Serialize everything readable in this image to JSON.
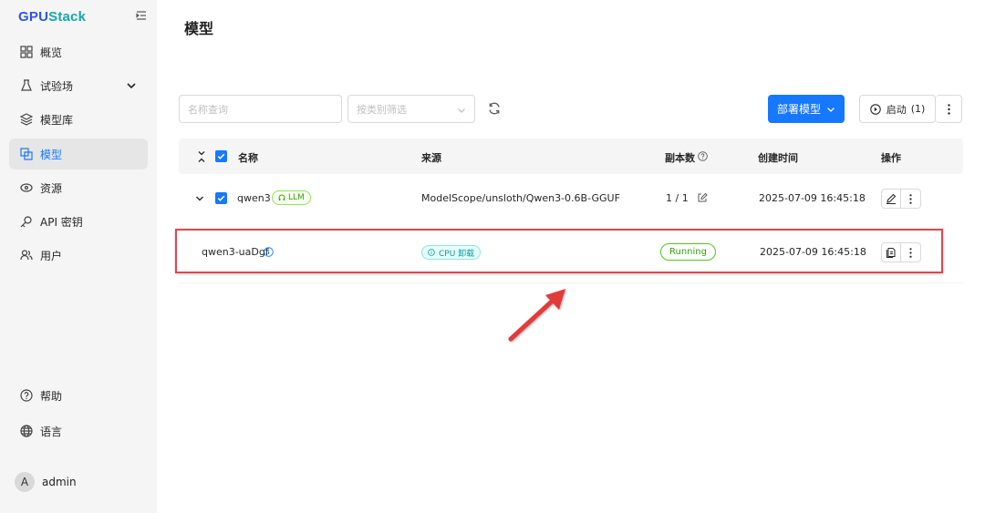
{
  "app": {
    "logo_prefix": "GPU",
    "logo_suffix": "Stack"
  },
  "sidebar": {
    "items": [
      {
        "label": "概览",
        "icon": "dashboard-icon"
      },
      {
        "label": "试验场",
        "icon": "flask-icon"
      },
      {
        "label": "模型库",
        "icon": "layers-icon"
      },
      {
        "label": "模型",
        "icon": "models-icon"
      },
      {
        "label": "资源",
        "icon": "resources-icon"
      },
      {
        "label": "API 密钥",
        "icon": "key-icon"
      },
      {
        "label": "用户",
        "icon": "users-icon"
      }
    ],
    "help_label": "帮助",
    "language_label": "语言",
    "user_initial": "A",
    "user_name": "admin",
    "accent_color": "#1677ff"
  },
  "page": {
    "title": "模型"
  },
  "toolbar": {
    "search_placeholder": "名称查询",
    "category_placeholder": "按类别筛选",
    "deploy_label": "部署模型",
    "start_label": "启动",
    "start_count": "(1)"
  },
  "table": {
    "headers": {
      "name": "名称",
      "source": "来源",
      "replicas": "副本数",
      "created": "创建时间",
      "actions": "操作"
    },
    "model_row": {
      "name": "qwen3",
      "tag": "LLM",
      "source": "ModelScope/unsloth/Qwen3-0.6B-GGUF",
      "replicas": "1 / 1",
      "created": "2025-07-09 16:45:18"
    },
    "instance_row": {
      "name": "qwen3-uaDgf",
      "tag": "CPU 卸载",
      "status": "Running",
      "created": "2025-07-09 16:45:18"
    }
  },
  "colors": {
    "primary": "#1677ff",
    "highlight_border": "#e0464c",
    "running": "#52c41a"
  }
}
